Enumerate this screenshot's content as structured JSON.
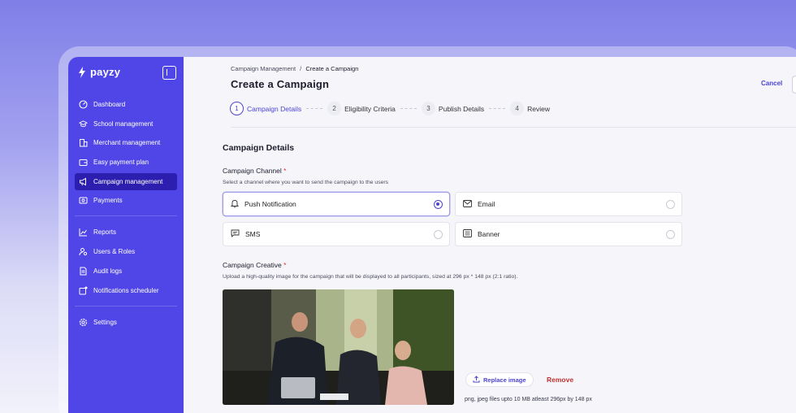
{
  "brand": {
    "name": "payzy"
  },
  "sidebar": {
    "items": [
      {
        "label": "Dashboard",
        "icon": "dashboard-icon"
      },
      {
        "label": "School management",
        "icon": "graduation-cap-icon"
      },
      {
        "label": "Merchant management",
        "icon": "building-icon"
      },
      {
        "label": "Easy payment plan",
        "icon": "wallet-icon"
      },
      {
        "label": "Campaign management",
        "icon": "megaphone-icon",
        "active": true
      },
      {
        "label": "Payments",
        "icon": "payment-icon"
      }
    ],
    "items2": [
      {
        "label": "Reports",
        "icon": "chart-line-icon"
      },
      {
        "label": "Users & Roles",
        "icon": "user-gear-icon"
      },
      {
        "label": "Audit logs",
        "icon": "document-icon"
      },
      {
        "label": "Notifications scheduler",
        "icon": "notification-icon"
      }
    ],
    "items3": [
      {
        "label": "Settings",
        "icon": "gear-icon"
      }
    ]
  },
  "breadcrumb": {
    "parent": "Campaign Management",
    "separator": "/",
    "current": "Create a Campaign"
  },
  "header": {
    "title": "Create a Campaign",
    "cancel_label": "Cancel"
  },
  "stepper": [
    {
      "num": "1",
      "label": "Campaign Details",
      "active": true
    },
    {
      "num": "2",
      "label": "Eligibility Criteria"
    },
    {
      "num": "3",
      "label": "Publish Details"
    },
    {
      "num": "4",
      "label": "Review"
    }
  ],
  "form": {
    "section_title": "Campaign Details",
    "channel": {
      "label": "Campaign Channel",
      "required": "*",
      "hint": "Select a channel where you want to send the campaign to the users",
      "options": [
        {
          "label": "Push Notification",
          "icon": "bell-icon",
          "selected": true
        },
        {
          "label": "Email",
          "icon": "mail-icon"
        },
        {
          "label": "SMS",
          "icon": "message-icon"
        },
        {
          "label": "Banner",
          "icon": "banner-icon"
        }
      ]
    },
    "creative": {
      "label": "Campaign Creative",
      "required": "*",
      "hint": "Upload a high-quality image for the campaign that will be displayed to all participants, sized at 296 px * 148 px (2:1 ratio).",
      "replace_label": "Replace image",
      "remove_label": "Remove",
      "file_hint": "png, jpeg files upto 10 MB atleast 296px by 148 px"
    }
  },
  "colors": {
    "brand": "#5046e8",
    "active_nav": "#2c1fb0",
    "accent": "#4b44d4",
    "danger": "#c0322f"
  }
}
